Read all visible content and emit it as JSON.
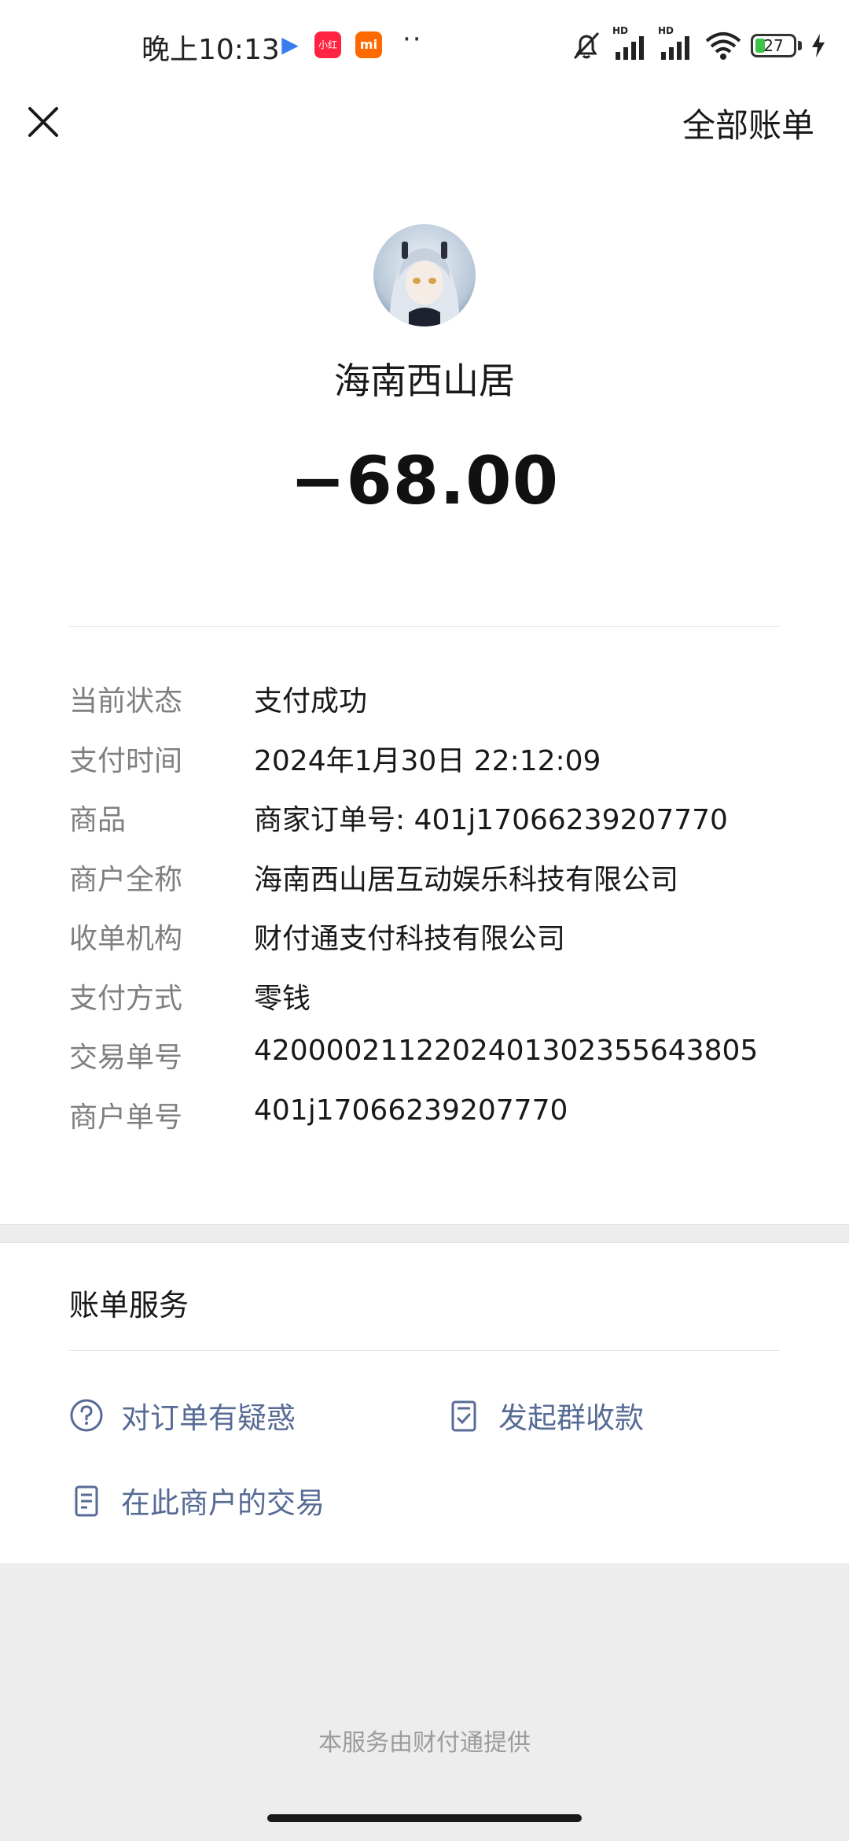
{
  "status_bar": {
    "time": "晚上10:13",
    "apps": [
      "play-store-icon",
      "xiaohongshu-icon",
      "mi-icon"
    ],
    "app_labels": {
      "xiaohongshu": "小红书",
      "mi": "mi"
    },
    "signal_label_1": "HD",
    "signal_label_2": "HD",
    "battery_level": "27",
    "battery_fraction": 0.27
  },
  "nav": {
    "close_icon": "close-icon",
    "all_bills_label": "全部账单"
  },
  "merchant": {
    "name": "海南西山居",
    "amount": "−68.00"
  },
  "details": [
    {
      "label": "当前状态",
      "value": "支付成功"
    },
    {
      "label": "支付时间",
      "value": "2024年1月30日 22:12:09"
    },
    {
      "label": "商品",
      "value": "商家订单号: 401j17066239207770"
    },
    {
      "label": "商户全称",
      "value": "海南西山居互动娱乐科技有限公司"
    },
    {
      "label": "收单机构",
      "value": "财付通支付科技有限公司"
    },
    {
      "label": "支付方式",
      "value": "零钱"
    },
    {
      "label": "交易单号",
      "value": "4200002112202401302355643805"
    },
    {
      "label": "商户单号",
      "value": "401j17066239207770"
    }
  ],
  "services": {
    "title": "账单服务",
    "items": [
      {
        "label": "对订单有疑惑",
        "icon": "question-circle-icon"
      },
      {
        "label": "发起群收款",
        "icon": "checklist-icon"
      },
      {
        "label": "在此商户的交易",
        "icon": "document-icon"
      }
    ]
  },
  "footer": {
    "text": "本服务由财付通提供"
  },
  "colors": {
    "link": "#576b95",
    "label": "#7f7f7f",
    "text": "#191919",
    "separator": "#ededed",
    "battery": "#3ec24a"
  }
}
